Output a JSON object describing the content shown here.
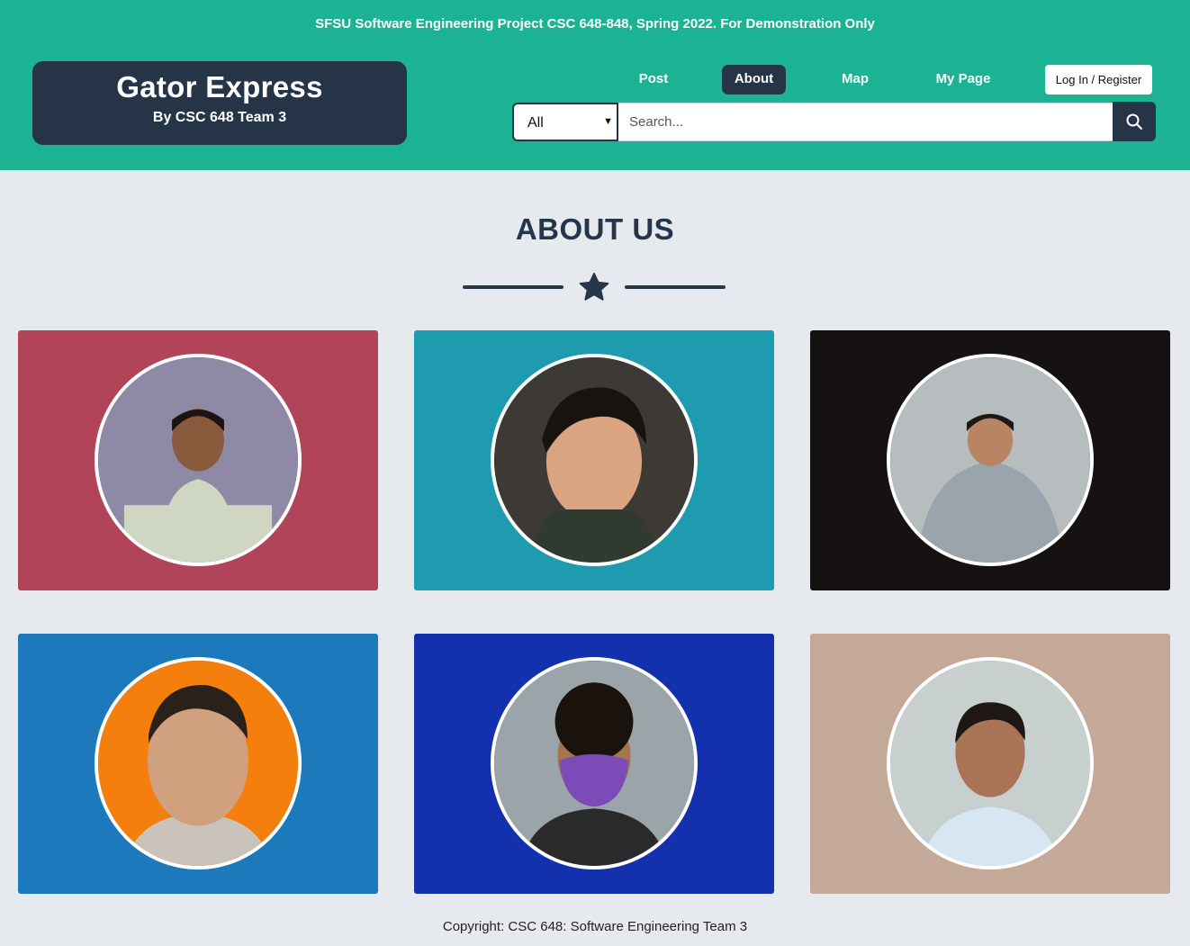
{
  "banner": "SFSU Software Engineering Project CSC 648-848, Spring 2022. For Demonstration Only",
  "brand": {
    "title": "Gator Express",
    "subtitle": "By CSC 648 Team 3"
  },
  "nav": {
    "post": "Post",
    "about": "About",
    "map": "Map",
    "my_page": "My Page",
    "login": "Log In / Register"
  },
  "search": {
    "category": "All",
    "placeholder": "Search..."
  },
  "page": {
    "heading": "ABOUT US"
  },
  "team": [
    {
      "card_color": "#b24459",
      "avatar_bg": "#8e8aa6",
      "skin": "#8a5a3c",
      "hair": "#1c1412",
      "shirt": "#cfd6c2"
    },
    {
      "card_color": "#1f9baf",
      "avatar_bg": "#3d3a36",
      "skin": "#d9a47f",
      "hair": "#17130f",
      "shirt": "#2f3a30"
    },
    {
      "card_color": "#171212",
      "avatar_bg": "#b7bcbf",
      "skin": "#b98462",
      "hair": "#1e1814",
      "shirt": "#9aa4ad"
    },
    {
      "card_color": "#1c79bb",
      "avatar_bg": "#f57f0c",
      "skin": "#d0a07f",
      "hair": "#2a211b",
      "shirt": "#c9c3bb"
    },
    {
      "card_color": "#1330ad",
      "avatar_bg": "#9ba4a8",
      "skin": "#a8744f",
      "hair": "#1a120d",
      "shirt": "#2a2a2a"
    },
    {
      "card_color": "#c4a898",
      "avatar_bg": "#c8cfcf",
      "skin": "#a97356",
      "hair": "#1e1713",
      "shirt": "#d8e6f3"
    }
  ],
  "footer": "Copyright: CSC 648: Software Engineering Team 3",
  "colors": {
    "header": "#1bb394",
    "navy": "#253447",
    "page_bg": "#e6e9ee"
  }
}
